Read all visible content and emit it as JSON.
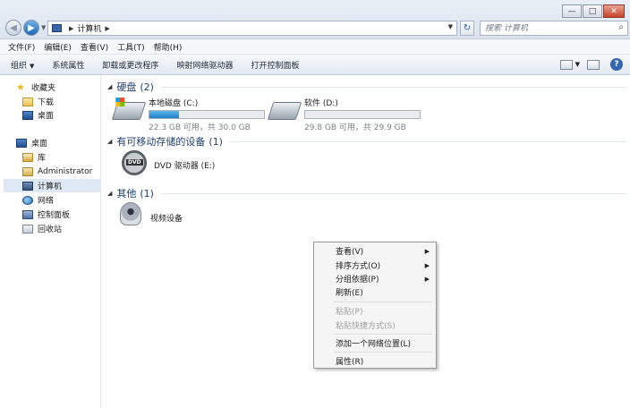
{
  "window": {
    "buttons": {
      "minimize": "—",
      "maximize": "□",
      "close": "✕"
    }
  },
  "address": {
    "path": "计算机",
    "search_placeholder": "搜索 计算机"
  },
  "menu": [
    "文件(F)",
    "编辑(E)",
    "查看(V)",
    "工具(T)",
    "帮助(H)"
  ],
  "toolbar": [
    "组织",
    "系统属性",
    "卸载或更改程序",
    "映射网络驱动器",
    "打开控制面板"
  ],
  "nav": {
    "favorites": {
      "label": "收藏夹",
      "items": [
        "下载",
        "桌面"
      ]
    },
    "desktop": {
      "label": "桌面",
      "items": [
        "库",
        "Administrator",
        "计算机",
        "网络",
        "控制面板",
        "回收站"
      ]
    }
  },
  "groups": {
    "hard_disks": {
      "title": "硬盘",
      "count": "(2)"
    },
    "removable": {
      "title": "有可移动存储的设备",
      "count": "(1)"
    },
    "other": {
      "title": "其他",
      "count": "(1)"
    }
  },
  "drives": [
    {
      "name": "本地磁盘 (C:)",
      "info": "22.3 GB 可用，共 30.0 GB",
      "used_fraction": 0.257
    },
    {
      "name": "软件 (D:)",
      "info": "29.8 GB 可用，共 29.9 GB",
      "used_fraction": 0.003
    }
  ],
  "removable_device": {
    "name": "DVD 驱动器 (E:)",
    "badge": "DVD"
  },
  "other_device": {
    "name": "视频设备"
  },
  "context_menu": [
    {
      "label": "查看(V)",
      "submenu": true,
      "disabled": false
    },
    {
      "label": "排序方式(O)",
      "submenu": true,
      "disabled": false
    },
    {
      "label": "分组依据(P)",
      "submenu": true,
      "disabled": false
    },
    {
      "label": "刷新(E)",
      "submenu": false,
      "disabled": false
    },
    {
      "label": "粘贴(P)",
      "submenu": false,
      "disabled": true
    },
    {
      "label": "粘贴快捷方式(S)",
      "submenu": false,
      "disabled": true
    },
    {
      "label": "添加一个网络位置(L)",
      "submenu": false,
      "disabled": false
    },
    {
      "label": "属性(R)",
      "submenu": false,
      "disabled": false
    }
  ]
}
